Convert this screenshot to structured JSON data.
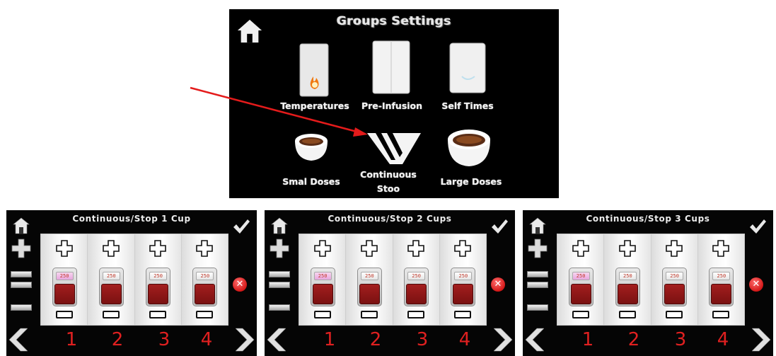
{
  "groups_settings": {
    "title": "Groups Settings",
    "items": [
      {
        "label": "Temperatures",
        "icon": "thermometer-flame-icon"
      },
      {
        "label": "Pre-Infusion",
        "icon": "pre-infusion-icon"
      },
      {
        "label": "Self Times",
        "icon": "self-times-icon"
      },
      {
        "label": "Smal Doses",
        "icon": "small-cup-icon"
      },
      {
        "label": "Continuous\nStoo",
        "icon": "continuous-stop-icon"
      },
      {
        "label": "Large Doses",
        "icon": "large-cup-icon"
      }
    ]
  },
  "panels": [
    {
      "title": "Continuous/Stop 1 Cup",
      "values": [
        "250",
        "250",
        "250",
        "250"
      ],
      "numbers": [
        "1",
        "2",
        "3",
        "4"
      ]
    },
    {
      "title": "Continuous/Stop 2 Cups",
      "values": [
        "250",
        "250",
        "250",
        "250"
      ],
      "numbers": [
        "1",
        "2",
        "3",
        "4"
      ]
    },
    {
      "title": "Continuous/Stop 3 Cups",
      "values": [
        "250",
        "250",
        "250",
        "250"
      ],
      "numbers": [
        "1",
        "2",
        "3",
        "4"
      ]
    }
  ],
  "colors": {
    "accent_red": "#e02020",
    "cup_red": "#8b1616",
    "arrow_red": "#e41b1b",
    "background": "#000000"
  }
}
